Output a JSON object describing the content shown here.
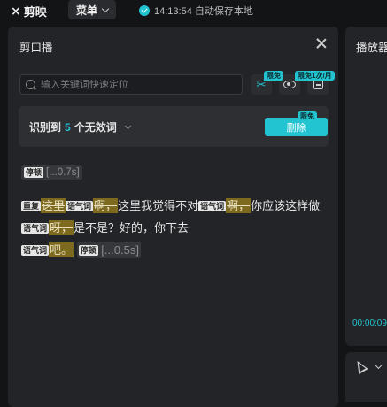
{
  "topbar": {
    "app_name": "剪映",
    "menu_label": "菜单",
    "autosave_text": "14:13:54 自动保存本地"
  },
  "panel": {
    "title": "剪口播",
    "search_placeholder": "输入关键词快速定位",
    "badges": {
      "cut": "限免",
      "subtitle": "限免1次/月",
      "delete": "限免"
    },
    "recognition": {
      "prefix": "识别到",
      "count": "5",
      "suffix": "个无效词",
      "delete_label": "删除"
    },
    "pause_line": {
      "tag": "停顿",
      "duration": "[...0.7s]"
    },
    "transcript": {
      "t_repeat": "重复",
      "w1": "这里",
      "t_filler1": "语气词",
      "w2": "啊，",
      "s1": "这里我觉得不对",
      "t_filler2": "语气词",
      "w3": "啊，",
      "s2": "你应该这样做",
      "t_filler3": "语气词",
      "w4": "呀，",
      "s3": "是不是？好的，你下去",
      "t_filler4": "语气词",
      "w5": "吧。",
      "t_pause": "停顿",
      "pause_dur": "[...0.5s]"
    }
  },
  "player": {
    "title": "播放器",
    "timecode": "00:00:09"
  },
  "colors": {
    "accent": "#22c4d1",
    "highlight": "#7d6a1e",
    "panel_bg": "#232427",
    "app_bg": "#131416"
  }
}
